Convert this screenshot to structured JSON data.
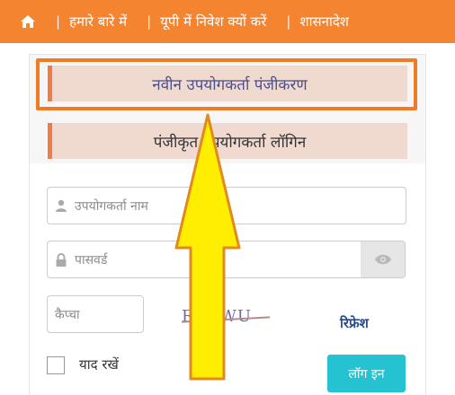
{
  "nav": {
    "items": [
      {
        "label": "हमारे बारे में"
      },
      {
        "label": "यूपी में निवेश क्यों करें"
      },
      {
        "label": "शासनादेश"
      }
    ],
    "separator": "|"
  },
  "tabs": {
    "register": "नवीन उपयोगकर्ता पंजीकरण",
    "login": "पंजीकृत उपयोगकर्ता लॉगिन"
  },
  "form": {
    "username_placeholder": "उपयोगकर्ता नाम",
    "password_placeholder": "पासवर्ड",
    "captcha_placeholder": "कैप्चा",
    "captcha_text": "RKSWU",
    "refresh_label": "रिफ्रेश",
    "remember_label": "याद रखें",
    "login_label": "लॉग इन"
  },
  "icons": {
    "home": "home-icon",
    "user": "user-icon",
    "lock": "lock-icon",
    "eye": "eye-icon",
    "arrow": "up-arrow-annotation"
  },
  "colors": {
    "navbar": "#f58430",
    "tab_bg": "#f0d9cf",
    "tab_accent": "#ef7b45",
    "highlight": "#ef7b25",
    "login_button": "#25c2d1",
    "arrow_fill": "#ffee00"
  }
}
